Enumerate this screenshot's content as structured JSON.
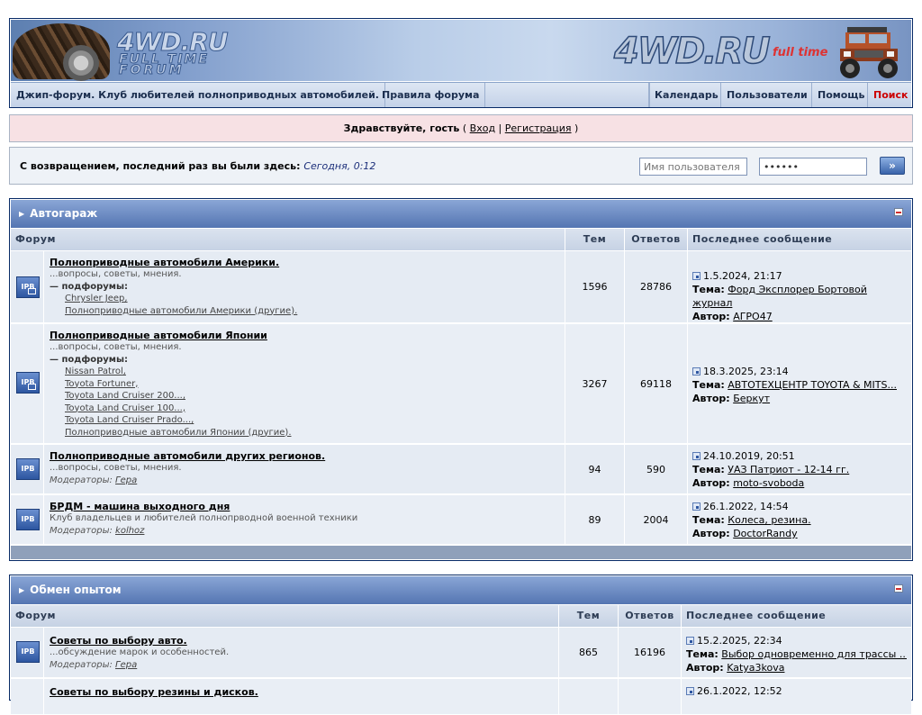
{
  "header": {
    "logo_left": [
      "4WD.RU",
      "FULL TIME",
      "FORUM"
    ],
    "logo_right": "4WD.RU",
    "logo_right_tag": "full time",
    "nav_left": [
      "Джип-форум. Клуб любителей полноприводных автомобилей.",
      "Правила форума"
    ],
    "nav_right": [
      "Календарь",
      "Пользователи",
      "Помощь",
      "Поиск"
    ]
  },
  "guest": {
    "greeting": "Здравствуйте, гость",
    "open": " ( ",
    "login": "Вход",
    "sep": " | ",
    "register": "Регистрация",
    "close": " )"
  },
  "welcome": {
    "text": "С возвращением, последний раз вы были здесь:",
    "time": "Сегодня, 0:12",
    "username_placeholder": "Имя пользователя",
    "password_value": "••••••",
    "go_label": "»"
  },
  "colors": {
    "header_blue": "#5475b2",
    "guest_bg": "#f7e1e4",
    "search_red": "#cc0000"
  },
  "columns": {
    "forum": "Форум",
    "topics": "Тем",
    "replies": "Ответов",
    "last": "Последнее сообщение"
  },
  "labels": {
    "subforums": "— подфорумы:",
    "moderators": "Модераторы:",
    "topic": "Тема:",
    "author": "Автор:"
  },
  "categories": [
    {
      "title": "Автогараж",
      "forums": [
        {
          "title": "Полноприводные автомобили Америки.",
          "desc": "...вопросы, советы, мнения.",
          "subforums": [
            "Chrysler Jeep,",
            "Полноприводные автомобили Америки (другие)."
          ],
          "topics": "1596",
          "replies": "28786",
          "last_date": "1.5.2024, 21:17",
          "last_topic": "Форд Эксплорер Бортовой журнал",
          "last_author": "АГРО47"
        },
        {
          "title": "Полноприводные автомобили Японии",
          "desc": "...вопросы, советы, мнения.",
          "subforums": [
            "Nissan Patrol,",
            "Toyota Fortuner,",
            "Toyota Land Cruiser 200...,",
            "Toyota Land Cruiser 100...,",
            "Toyota Land Cruiser Prado...,",
            "Полноприводные автомобили Японии (другие)."
          ],
          "topics": "3267",
          "replies": "69118",
          "last_date": "18.3.2025, 23:14",
          "last_topic": "АВТОТЕХЦЕНТР TOYOTA & MITS...",
          "last_author": "Беркут"
        },
        {
          "title": "Полноприводные автомобили других регионов.",
          "desc": "...вопросы, советы, мнения.",
          "moderator": "Гера",
          "topics": "94",
          "replies": "590",
          "last_date": "24.10.2019, 20:51",
          "last_topic": "УАЗ Патриот - 12-14 гг.",
          "last_author": "moto-svoboda"
        },
        {
          "title": "БРДМ - машина выходного дня",
          "desc": "Клуб владельцев и любителей полнопрводной военной техники",
          "moderator": "kolhoz",
          "topics": "89",
          "replies": "2004",
          "last_date": "26.1.2022, 14:54",
          "last_topic": "Колеса, резина.",
          "last_author": "DoctorRandy"
        }
      ]
    },
    {
      "title": "Обмен опытом",
      "forums": [
        {
          "title": "Советы по выбору авто.",
          "desc": "...обсуждение марок и особенностей.",
          "moderator": "Гера",
          "topics": "865",
          "replies": "16196",
          "last_date": "15.2.2025, 22:34",
          "last_topic": "Выбор одновременно для трассы ...",
          "last_author": "Katya3kova"
        },
        {
          "title": "Советы по выбору резины и дисков.",
          "last_date": "26.1.2022, 12:52"
        }
      ]
    }
  ]
}
